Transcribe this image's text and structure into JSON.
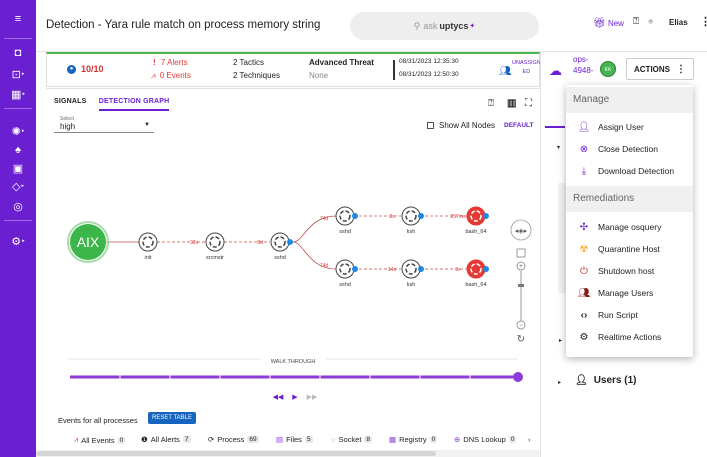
{
  "page_title": "Detection - Yara rule match on process memory string",
  "search": {
    "prefix": "ask",
    "brand": "uptycs",
    "spark": "✦"
  },
  "topbar": {
    "new_label": "New",
    "user_name": "Elias"
  },
  "summary": {
    "score": "10/10",
    "alerts": "7 Alerts",
    "events": "0 Events",
    "tactics": "2 Tactics",
    "techniques": "2 Techniques",
    "threat_title": "Advanced Threat",
    "threat_sub": "None",
    "start_time": "08/31/2023 12:35:30",
    "end_time": "08/31/2023 12:50:30",
    "unassign_label_1": "UNASSIGN",
    "unassign_label_2": "ED"
  },
  "tabs": [
    {
      "label": "SIGNALS",
      "active": false
    },
    {
      "label": "DETECTION GRAPH",
      "active": true
    }
  ],
  "graph": {
    "select_label": "Select",
    "select_value": "high",
    "show_all_nodes": "Show All Nodes",
    "default_label": "DEFAULT",
    "root_label": "AIX",
    "nodes": [
      {
        "label": "init"
      },
      {
        "label": "srcmstr"
      },
      {
        "label": "sshd"
      },
      {
        "label": "sshd"
      },
      {
        "label": "ksh"
      },
      {
        "label": "bash_64"
      },
      {
        "label": "sshd"
      },
      {
        "label": "ksh"
      },
      {
        "label": "bash_64"
      }
    ],
    "edge_labels": [
      "32s",
      "8d",
      "74d",
      "3s",
      "257ms",
      "74d",
      "14s",
      "3s"
    ],
    "walkthrough_label": "WALK THROUGH"
  },
  "events": {
    "title": "Events for all processes",
    "reset_label": "RESET TABLE",
    "filters": [
      {
        "label": "All Events",
        "count": "0"
      },
      {
        "label": "All Alerts",
        "count": "7"
      },
      {
        "label": "Process",
        "count": "69"
      },
      {
        "label": "Files",
        "count": "5"
      },
      {
        "label": "Socket",
        "count": "8"
      },
      {
        "label": "Registry",
        "count": "0"
      },
      {
        "label": "DNS Lookup",
        "count": "0"
      }
    ]
  },
  "right_panel": {
    "asset_line1": "ops-",
    "asset_line2": "4948-",
    "avatar": "KK",
    "actions_label": "ACTIONS",
    "users_label": "Users (1)"
  },
  "menu": {
    "manage_header": "Manage",
    "manage_items": [
      "Assign User",
      "Close Detection",
      "Download Detection"
    ],
    "remediations_header": "Remediations",
    "remediation_items": [
      "Manage osquery",
      "Quarantine Host",
      "Shutdown host",
      "Manage Users",
      "Run Script",
      "Realtime Actions"
    ]
  },
  "colors": {
    "accent": "#6a1fd1",
    "alert_red": "#e53935",
    "score_red": "#d32f2f",
    "root_green": "#3cb54a",
    "node_blue": "#1e88e5"
  }
}
